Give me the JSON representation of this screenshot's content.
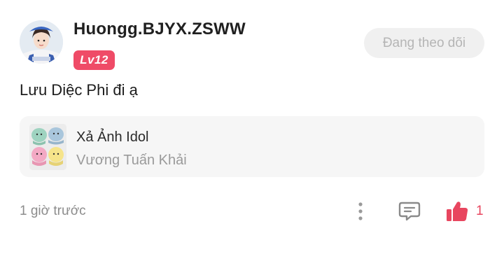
{
  "author": {
    "username": "Huongg.BJYX.ZSWW",
    "level": "Lv12"
  },
  "follow_button": {
    "label": "Đang theo dõi"
  },
  "post": {
    "text": "Lưu Diệc Phi đi ạ"
  },
  "linked_card": {
    "title": "Xả Ảnh Idol",
    "subtitle": "Vương Tuấn Khải"
  },
  "footer": {
    "timestamp": "1 giờ trước",
    "like_count": "1"
  },
  "colors": {
    "accent": "#ef4b67",
    "like": "#e8465f",
    "muted_text": "#8c8c8c",
    "card_bg": "#f6f6f6",
    "button_bg": "#f0f0f0"
  },
  "icons": [
    "more-vertical-icon",
    "comment-icon",
    "thumbs-up-icon"
  ]
}
